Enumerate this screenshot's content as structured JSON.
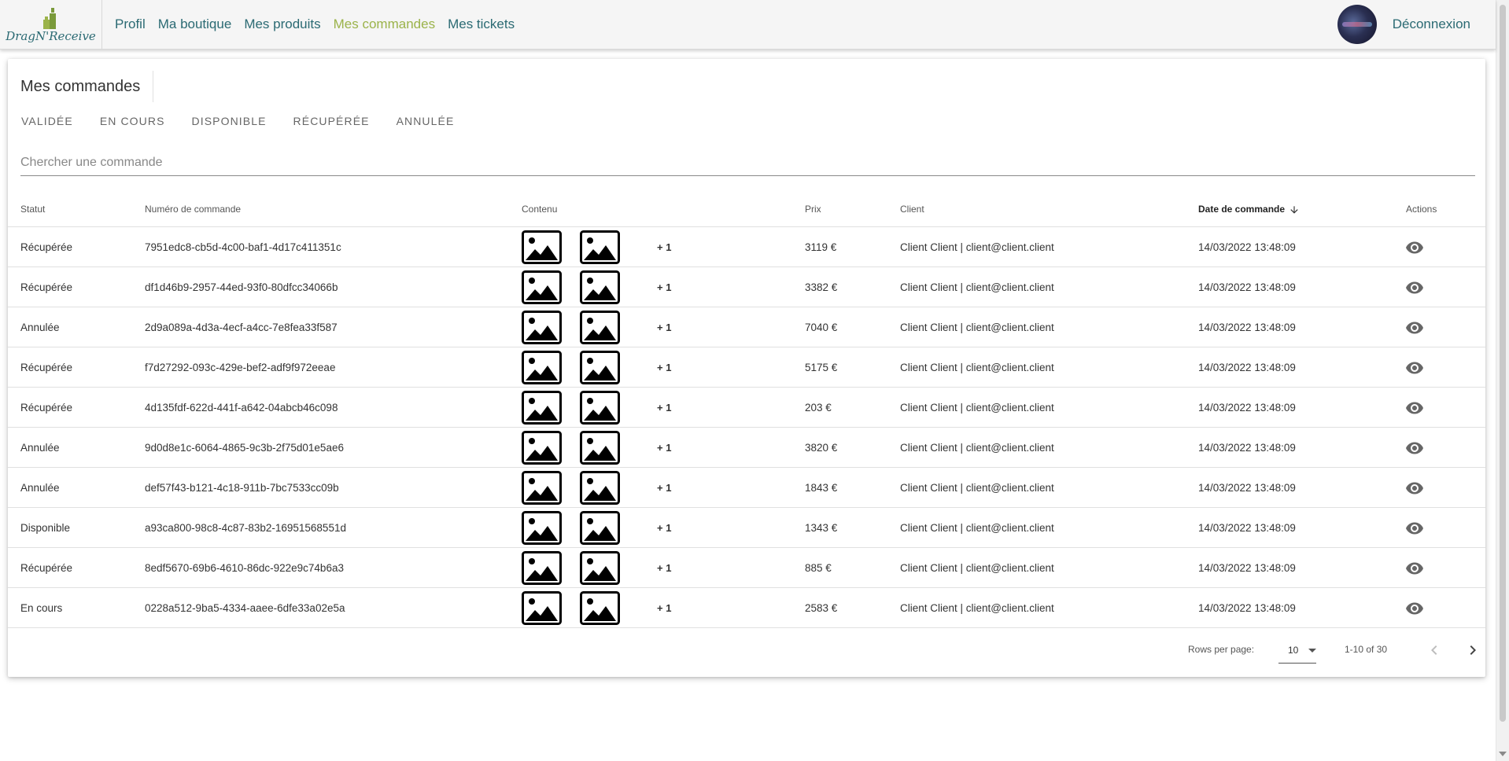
{
  "app": {
    "logo_text": "DragN'Receive"
  },
  "nav": {
    "links": [
      {
        "label": "Profil"
      },
      {
        "label": "Ma boutique"
      },
      {
        "label": "Mes produits"
      },
      {
        "label": "Mes commandes",
        "active": true
      },
      {
        "label": "Mes tickets"
      }
    ],
    "logout": "Déconnexion"
  },
  "page": {
    "title": "Mes commandes",
    "filters": [
      "VALIDÉE",
      "EN COURS",
      "DISPONIBLE",
      "RÉCUPÉRÉE",
      "ANNULÉE"
    ],
    "search_placeholder": "Chercher une commande"
  },
  "table": {
    "headers": {
      "status": "Statut",
      "order_number": "Numéro de commande",
      "content": "Contenu",
      "price": "Prix",
      "client": "Client",
      "date": "Date de commande",
      "actions": "Actions"
    },
    "sort": {
      "column": "date",
      "direction": "desc"
    },
    "rows": [
      {
        "status": "Récupérée",
        "order_number": "7951edc8-cb5d-4c00-baf1-4d17c411351c",
        "extra": "+ 1",
        "price": "3119 €",
        "client": "Client Client | client@client.client",
        "date": "14/03/2022 13:48:09"
      },
      {
        "status": "Récupérée",
        "order_number": "df1d46b9-2957-44ed-93f0-80dfcc34066b",
        "extra": "+ 1",
        "price": "3382 €",
        "client": "Client Client | client@client.client",
        "date": "14/03/2022 13:48:09"
      },
      {
        "status": "Annulée",
        "order_number": "2d9a089a-4d3a-4ecf-a4cc-7e8fea33f587",
        "extra": "+ 1",
        "price": "7040 €",
        "client": "Client Client | client@client.client",
        "date": "14/03/2022 13:48:09"
      },
      {
        "status": "Récupérée",
        "order_number": "f7d27292-093c-429e-bef2-adf9f972eeae",
        "extra": "+ 1",
        "price": "5175 €",
        "client": "Client Client | client@client.client",
        "date": "14/03/2022 13:48:09"
      },
      {
        "status": "Récupérée",
        "order_number": "4d135fdf-622d-441f-a642-04abcb46c098",
        "extra": "+ 1",
        "price": "203 €",
        "client": "Client Client | client@client.client",
        "date": "14/03/2022 13:48:09"
      },
      {
        "status": "Annulée",
        "order_number": "9d0d8e1c-6064-4865-9c3b-2f75d01e5ae6",
        "extra": "+ 1",
        "price": "3820 €",
        "client": "Client Client | client@client.client",
        "date": "14/03/2022 13:48:09"
      },
      {
        "status": "Annulée",
        "order_number": "def57f43-b121-4c18-911b-7bc7533cc09b",
        "extra": "+ 1",
        "price": "1843 €",
        "client": "Client Client | client@client.client",
        "date": "14/03/2022 13:48:09"
      },
      {
        "status": "Disponible",
        "order_number": "a93ca800-98c8-4c87-83b2-16951568551d",
        "extra": "+ 1",
        "price": "1343 €",
        "client": "Client Client | client@client.client",
        "date": "14/03/2022 13:48:09"
      },
      {
        "status": "Récupérée",
        "order_number": "8edf5670-69b6-4610-86dc-922e9c74b6a3",
        "extra": "+ 1",
        "price": "885 €",
        "client": "Client Client | client@client.client",
        "date": "14/03/2022 13:48:09"
      },
      {
        "status": "En cours",
        "order_number": "0228a512-9ba5-4334-aaee-6dfe33a02e5a",
        "extra": "+ 1",
        "price": "2583 €",
        "client": "Client Client | client@client.client",
        "date": "14/03/2022 13:48:09"
      }
    ]
  },
  "pagination": {
    "rows_per_page_label": "Rows per page:",
    "rows_per_page": "10",
    "range": "1-10 of 30"
  },
  "icons": {
    "content_image": "image-placeholder-icon",
    "action": "eye-icon",
    "sort": "arrow-down-icon",
    "prev": "chevron-left-icon",
    "next": "chevron-right-icon"
  },
  "colors": {
    "nav_link": "#2b6a73",
    "nav_active": "#9bb34a"
  }
}
